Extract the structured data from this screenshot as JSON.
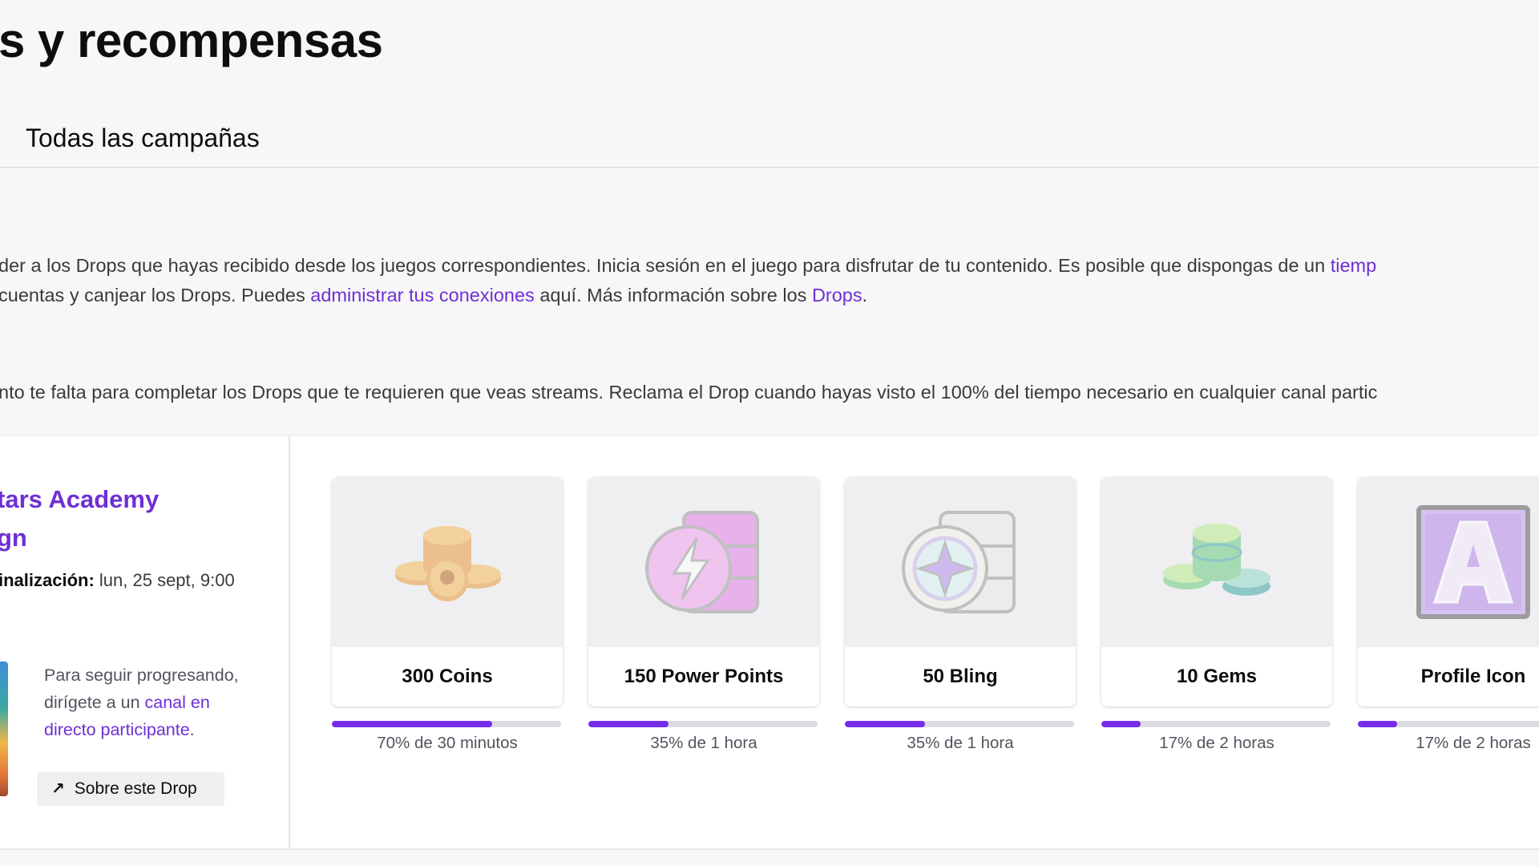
{
  "header": {
    "title": "s y recompensas",
    "tab_label": "Todas las campañas"
  },
  "intro": {
    "line1_a": "der a los Drops que hayas recibido desde los juegos correspondientes. Inicia sesión en el juego para disfrutar de tu contenido. Es posible que dispongas de un ",
    "line1_link": "tiemp",
    "line2_a": "cuentas y canjear los Drops. Puedes ",
    "line2_link": "administrar tus conexiones",
    "line2_b": " aquí. Más información sobre los ",
    "line2_link2": "Drops",
    "line2_c": "."
  },
  "progress_note": "nto te falta para completar los Drops que te requieren que veas streams. Reclama el Drop cuando hayas visto el 100% del tiempo necesario en cualquier canal partic",
  "campaign": {
    "name_line1": "tars Academy",
    "name_line2": "gn",
    "end_label": "inalización:",
    "end_value": " lun, 25 sept, 9:00",
    "hint_a": "Para seguir progresando, dirígete a un ",
    "hint_link": "canal en directo participante",
    "hint_b": ".",
    "about_button": "Sobre este Drop"
  },
  "drops": [
    {
      "name": "300 Coins",
      "progress_pct": 70,
      "label": "70% de 30 minutos",
      "icon": "coins-icon"
    },
    {
      "name": "150 Power Points",
      "progress_pct": 35,
      "label": "35% de 1 hora",
      "icon": "power-points-icon"
    },
    {
      "name": "50 Bling",
      "progress_pct": 35,
      "label": "35% de 1 hora",
      "icon": "bling-icon"
    },
    {
      "name": "10 Gems",
      "progress_pct": 17,
      "label": "17% de 2 horas",
      "icon": "gems-icon"
    },
    {
      "name": "Profile Icon",
      "progress_pct": 17,
      "label": "17% de 2 horas",
      "icon": "profile-icon-letter-a"
    }
  ],
  "colors": {
    "accent": "#772ce8",
    "link": "#6e2fd5",
    "background": "#f7f7f8"
  }
}
